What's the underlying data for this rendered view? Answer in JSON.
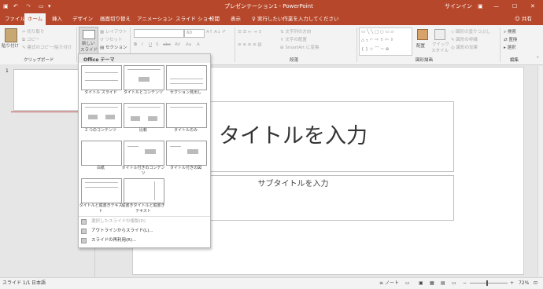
{
  "app": {
    "title": "プレゼンテーション1 - PowerPoint",
    "signin": "サインイン",
    "share": "共有",
    "qat_more": "▾"
  },
  "tabs": [
    {
      "label": "ファイル"
    },
    {
      "label": "ホーム"
    },
    {
      "label": "挿入"
    },
    {
      "label": "デザイン"
    },
    {
      "label": "画面切り替え"
    },
    {
      "label": "アニメーション"
    },
    {
      "label": "スライド ショー"
    },
    {
      "label": "校閲"
    },
    {
      "label": "表示"
    }
  ],
  "tellme": "実行したい作業を入力してください",
  "ribbon": {
    "clipboard": {
      "paste": "貼り付け",
      "cut": "切り取り",
      "copy": "コピー",
      "format_painter": "書式のコピー/貼り付け",
      "group": "クリップボード"
    },
    "slides": {
      "new_slide": "新しい",
      "new_slide_2": "スライド",
      "layout": "レイアウト",
      "reset": "リセット",
      "section": "セクション"
    },
    "font": {
      "size": "60"
    },
    "paragraph": {
      "text_direction": "文字列の方向",
      "align_text": "文字の配置",
      "smartart": "SmartArt に変換",
      "group": "段落"
    },
    "drawing": {
      "arrange": "配置",
      "quick_styles": "クイック",
      "quick_styles_2": "スタイル",
      "fill": "図形の塗りつぶし",
      "outline": "図形の枠線",
      "effects": "図形の効果",
      "group": "図形描画"
    },
    "editing": {
      "find": "検索",
      "replace": "置換",
      "select": "選択",
      "group": "編集"
    }
  },
  "thumbnail_number": "1",
  "slide": {
    "title_placeholder": "タイトルを入力",
    "subtitle_placeholder": "サブタイトルを入力"
  },
  "gallery": {
    "header": "Office テーマ",
    "layouts": [
      {
        "label": "タイトル スライド"
      },
      {
        "label": "タイトルとコンテンツ"
      },
      {
        "label": "セクション見出し"
      },
      {
        "label": "2 つのコンテンツ"
      },
      {
        "label": "比較"
      },
      {
        "label": "タイトルのみ"
      },
      {
        "label": "白紙"
      },
      {
        "label": "タイトル付きのコンテンツ"
      },
      {
        "label": "タイトル付きの図"
      },
      {
        "label": "タイトルと縦書きテキスト"
      },
      {
        "label": "縦書きタイトルと縦書きテキスト"
      }
    ],
    "menu": [
      {
        "label": "選択したスライドの複製(D)",
        "disabled": true
      },
      {
        "label": "アウトラインからスライド(L)...",
        "disabled": false
      },
      {
        "label": "スライドの再利用(R)...",
        "disabled": false
      }
    ]
  },
  "status": {
    "slide_count": "スライド 1/1",
    "language": "日本語",
    "notes": "ノート",
    "zoom": "72%"
  },
  "colors": {
    "brand": "#b7472a",
    "ribbon_bg": "#f3f3f3",
    "workspace_bg": "#e6e6e6"
  }
}
